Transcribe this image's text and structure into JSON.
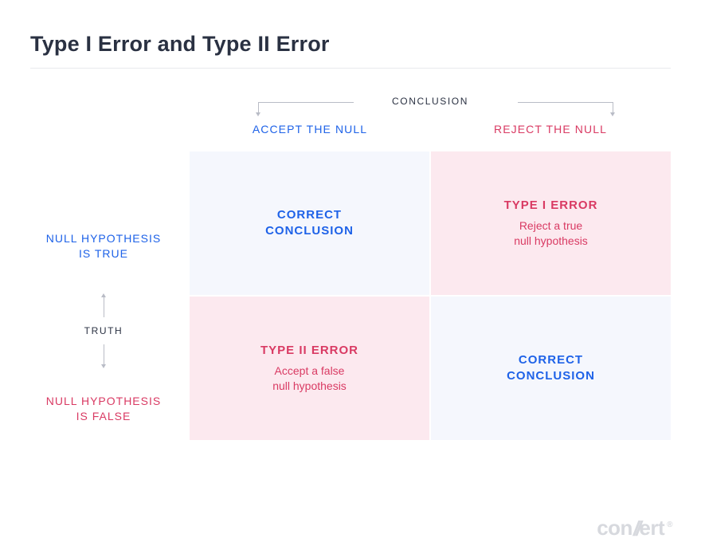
{
  "title": "Type I Error and Type II Error",
  "axes": {
    "conclusion": "CONCLUSION",
    "truth": "TRUTH"
  },
  "columns": {
    "accept": "ACCEPT THE NULL",
    "reject": "REJECT THE NULL"
  },
  "rows": {
    "true": "NULL HYPOTHESIS\nIS TRUE",
    "false": "NULL HYPOTHESIS\nIS FALSE"
  },
  "cells": {
    "true_accept": {
      "title": "CORRECT\nCONCLUSION",
      "sub": ""
    },
    "true_reject": {
      "title": "TYPE I ERROR",
      "sub": "Reject a true\nnull hypothesis"
    },
    "false_accept": {
      "title": "TYPE II ERROR",
      "sub": "Accept a false\nnull hypothesis"
    },
    "false_reject": {
      "title": "CORRECT\nCONCLUSION",
      "sub": ""
    }
  },
  "logo": "convert"
}
